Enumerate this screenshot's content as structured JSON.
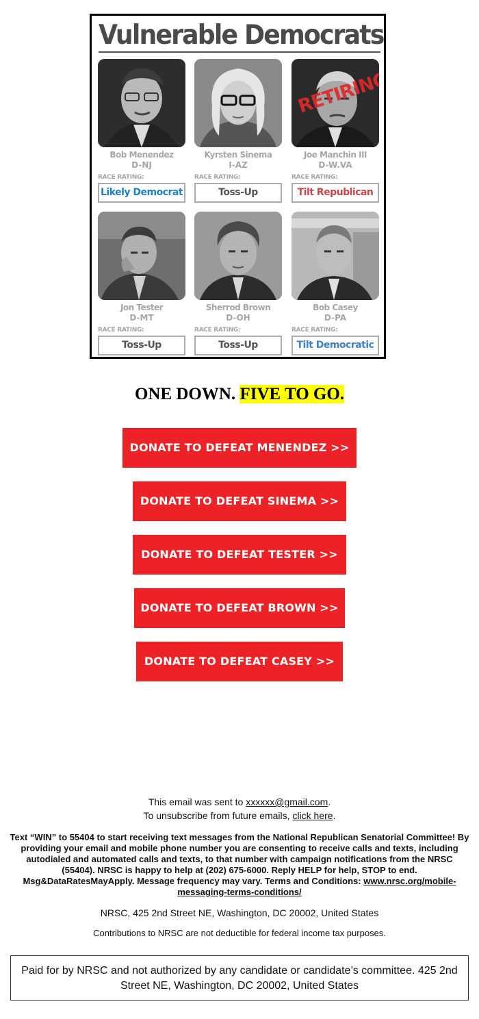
{
  "graphic": {
    "title": "Vulnerable Democrats",
    "race_rating_label": "RACE RATING:",
    "retiring_stamp": "RETIRING",
    "senators": [
      {
        "name": "Bob Menendez",
        "party": "D-NJ",
        "rating": "Likely Democrat",
        "rating_color": "#1f7ec2"
      },
      {
        "name": "Kyrsten Sinema",
        "party": "I-AZ",
        "rating": "Toss-Up",
        "rating_color": "#555555"
      },
      {
        "name": "Joe Manchin III",
        "party": "D-W.VA",
        "rating": "Tilt Republican",
        "rating_color": "#c8464b"
      },
      {
        "name": "Jon Tester",
        "party": "D-MT",
        "rating": "Toss-Up",
        "rating_color": "#555555"
      },
      {
        "name": "Sherrod Brown",
        "party": "D-OH",
        "rating": "Toss-Up",
        "rating_color": "#555555"
      },
      {
        "name": "Bob Casey",
        "party": "D-PA",
        "rating": "Tilt Democratic",
        "rating_color": "#3f83c2"
      }
    ]
  },
  "headline": {
    "part1": "ONE DOWN. ",
    "part2": "FIVE TO GO."
  },
  "buttons": [
    {
      "label": "DONATE TO DEFEAT MENENDEZ >>"
    },
    {
      "label": "DONATE TO DEFEAT SINEMA >>"
    },
    {
      "label": "DONATE TO DEFEAT TESTER >>"
    },
    {
      "label": "DONATE TO DEFEAT BROWN >>"
    },
    {
      "label": "DONATE TO DEFEAT CASEY >>"
    }
  ],
  "footer": {
    "sent_to_prefix": "This email was sent to ",
    "email": "xxxxxx@gmail.com",
    "sent_to_suffix": ".",
    "unsubscribe_prefix": "To unsubscribe from future emails, ",
    "unsubscribe_link": "click here",
    "unsubscribe_suffix": ".",
    "sms_text": "Text “WIN” to 55404 to start receiving text messages from the National Republican Senatorial Committee! By providing your email and mobile phone number you are consenting to receive calls and texts, including autodialed and automated calls and texts, to that number with campaign notifications from the NRSC (55404). NRSC is happy to help at (202) 675-6000. Reply HELP for help, STOP to end. Msg&DataRatesMayApply. Message frequency may vary. Terms and Conditions: ",
    "sms_link": "www.nrsc.org/mobile-messaging-terms-conditions/",
    "address": "NRSC, 425 2nd Street NE, Washington, DC 20002, United States",
    "tax_note": "Contributions to NRSC are not deductible for federal income tax purposes.",
    "paid_for": "Paid for by NRSC and not authorized by any candidate or candidate’s committee. 425 2nd Street NE, Washington, DC 20002, United States"
  }
}
